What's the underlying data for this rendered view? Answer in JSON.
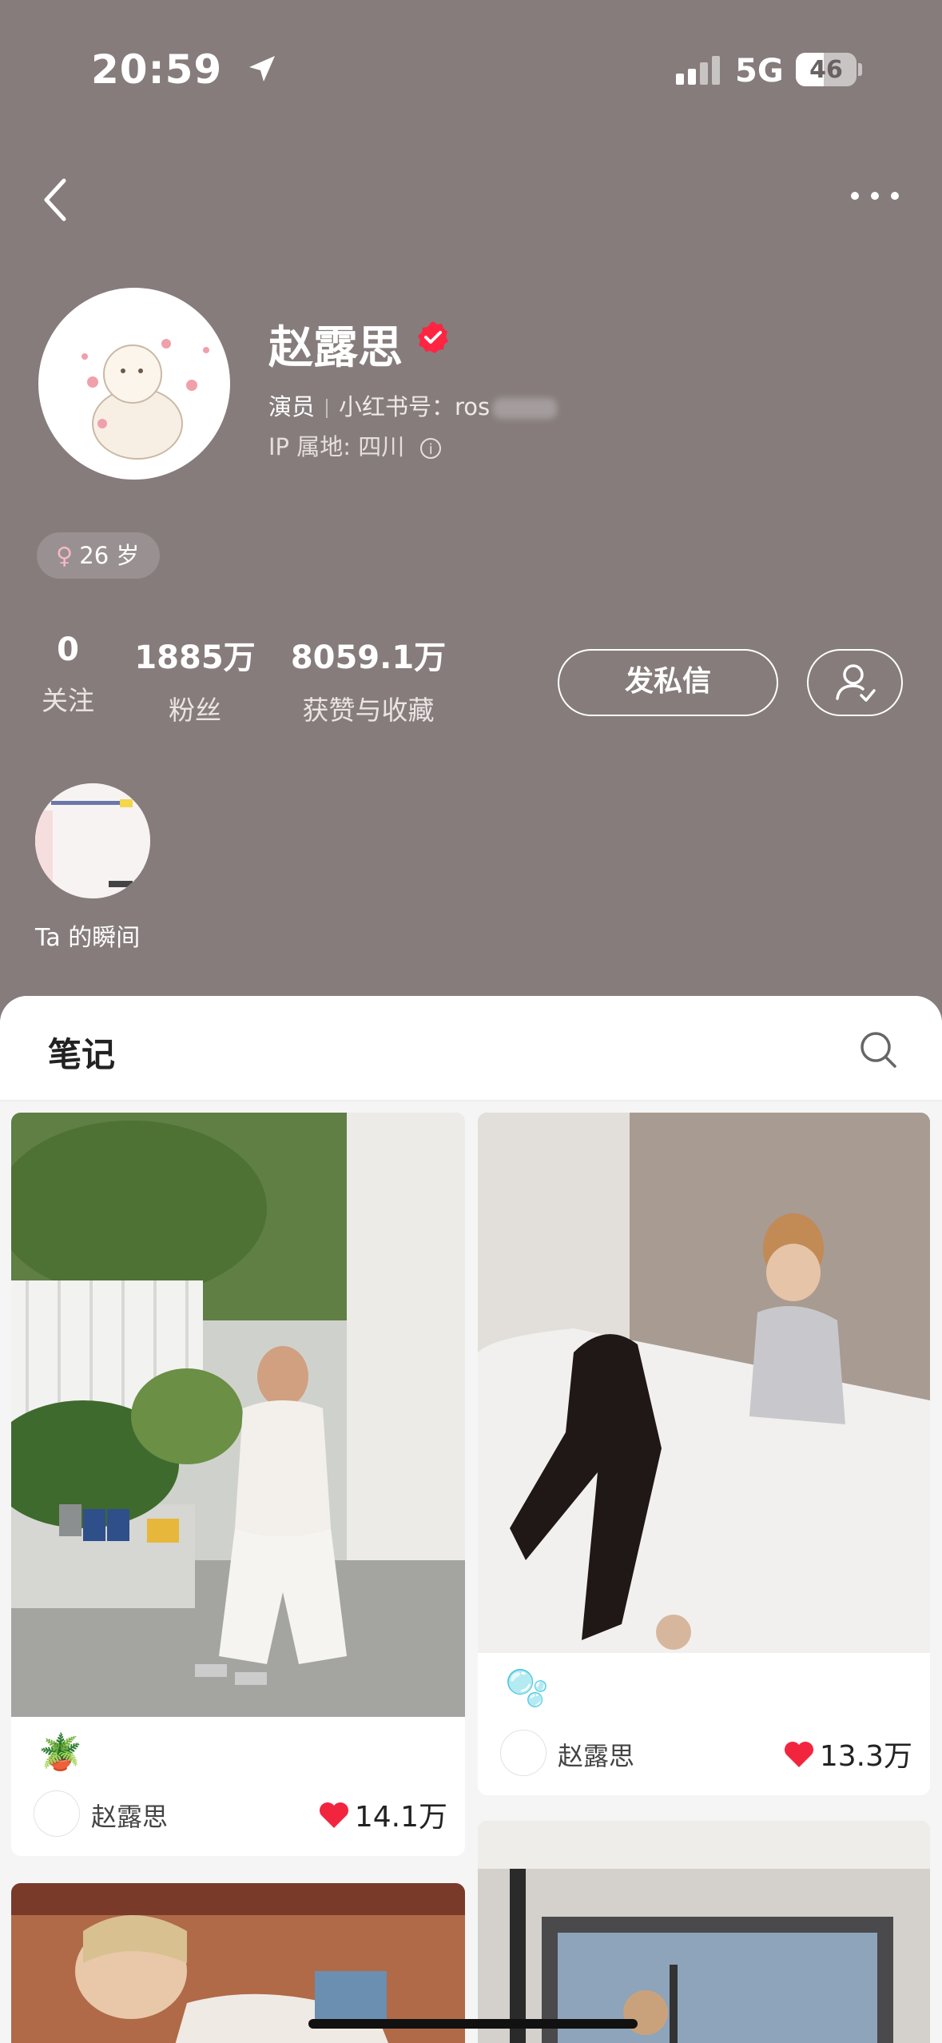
{
  "status_bar": {
    "time": "20:59",
    "network": "5G",
    "battery": "46"
  },
  "profile": {
    "name": "赵露思",
    "role": "演员",
    "id_label": "小红书号：ros",
    "ip_location": "IP 属地: 四川",
    "gender_age": "26 岁",
    "gender_symbol": "♀"
  },
  "stats": [
    {
      "value": "0",
      "label": "关注"
    },
    {
      "value": "1885万",
      "label": "粉丝"
    },
    {
      "value": "8059.1万",
      "label": "获赞与收藏"
    }
  ],
  "actions": {
    "message": "发私信"
  },
  "moments": {
    "label": "Ta 的瞬间"
  },
  "notes": {
    "title": "笔记",
    "cards": [
      {
        "author": "赵露思",
        "likes": "14.1万",
        "emoji": "🪴"
      },
      {
        "author": "赵露思",
        "likes": "13.3万",
        "emoji": "🫧"
      }
    ]
  },
  "colors": {
    "header_bg": "#867c7c",
    "accent_red": "#ff2442",
    "heart": "#f2253f"
  }
}
